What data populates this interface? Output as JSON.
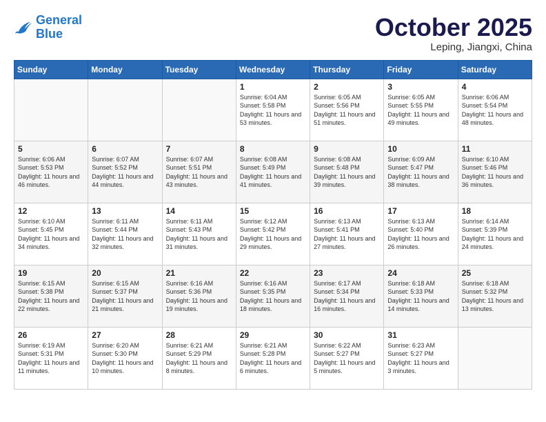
{
  "header": {
    "logo_line1": "General",
    "logo_line2": "Blue",
    "month": "October 2025",
    "location": "Leping, Jiangxi, China"
  },
  "days_of_week": [
    "Sunday",
    "Monday",
    "Tuesday",
    "Wednesday",
    "Thursday",
    "Friday",
    "Saturday"
  ],
  "weeks": [
    [
      {
        "num": "",
        "info": ""
      },
      {
        "num": "",
        "info": ""
      },
      {
        "num": "",
        "info": ""
      },
      {
        "num": "1",
        "info": "Sunrise: 6:04 AM\nSunset: 5:58 PM\nDaylight: 11 hours and 53 minutes."
      },
      {
        "num": "2",
        "info": "Sunrise: 6:05 AM\nSunset: 5:56 PM\nDaylight: 11 hours and 51 minutes."
      },
      {
        "num": "3",
        "info": "Sunrise: 6:05 AM\nSunset: 5:55 PM\nDaylight: 11 hours and 49 minutes."
      },
      {
        "num": "4",
        "info": "Sunrise: 6:06 AM\nSunset: 5:54 PM\nDaylight: 11 hours and 48 minutes."
      }
    ],
    [
      {
        "num": "5",
        "info": "Sunrise: 6:06 AM\nSunset: 5:53 PM\nDaylight: 11 hours and 46 minutes."
      },
      {
        "num": "6",
        "info": "Sunrise: 6:07 AM\nSunset: 5:52 PM\nDaylight: 11 hours and 44 minutes."
      },
      {
        "num": "7",
        "info": "Sunrise: 6:07 AM\nSunset: 5:51 PM\nDaylight: 11 hours and 43 minutes."
      },
      {
        "num": "8",
        "info": "Sunrise: 6:08 AM\nSunset: 5:49 PM\nDaylight: 11 hours and 41 minutes."
      },
      {
        "num": "9",
        "info": "Sunrise: 6:08 AM\nSunset: 5:48 PM\nDaylight: 11 hours and 39 minutes."
      },
      {
        "num": "10",
        "info": "Sunrise: 6:09 AM\nSunset: 5:47 PM\nDaylight: 11 hours and 38 minutes."
      },
      {
        "num": "11",
        "info": "Sunrise: 6:10 AM\nSunset: 5:46 PM\nDaylight: 11 hours and 36 minutes."
      }
    ],
    [
      {
        "num": "12",
        "info": "Sunrise: 6:10 AM\nSunset: 5:45 PM\nDaylight: 11 hours and 34 minutes."
      },
      {
        "num": "13",
        "info": "Sunrise: 6:11 AM\nSunset: 5:44 PM\nDaylight: 11 hours and 32 minutes."
      },
      {
        "num": "14",
        "info": "Sunrise: 6:11 AM\nSunset: 5:43 PM\nDaylight: 11 hours and 31 minutes."
      },
      {
        "num": "15",
        "info": "Sunrise: 6:12 AM\nSunset: 5:42 PM\nDaylight: 11 hours and 29 minutes."
      },
      {
        "num": "16",
        "info": "Sunrise: 6:13 AM\nSunset: 5:41 PM\nDaylight: 11 hours and 27 minutes."
      },
      {
        "num": "17",
        "info": "Sunrise: 6:13 AM\nSunset: 5:40 PM\nDaylight: 11 hours and 26 minutes."
      },
      {
        "num": "18",
        "info": "Sunrise: 6:14 AM\nSunset: 5:39 PM\nDaylight: 11 hours and 24 minutes."
      }
    ],
    [
      {
        "num": "19",
        "info": "Sunrise: 6:15 AM\nSunset: 5:38 PM\nDaylight: 11 hours and 22 minutes."
      },
      {
        "num": "20",
        "info": "Sunrise: 6:15 AM\nSunset: 5:37 PM\nDaylight: 11 hours and 21 minutes."
      },
      {
        "num": "21",
        "info": "Sunrise: 6:16 AM\nSunset: 5:36 PM\nDaylight: 11 hours and 19 minutes."
      },
      {
        "num": "22",
        "info": "Sunrise: 6:16 AM\nSunset: 5:35 PM\nDaylight: 11 hours and 18 minutes."
      },
      {
        "num": "23",
        "info": "Sunrise: 6:17 AM\nSunset: 5:34 PM\nDaylight: 11 hours and 16 minutes."
      },
      {
        "num": "24",
        "info": "Sunrise: 6:18 AM\nSunset: 5:33 PM\nDaylight: 11 hours and 14 minutes."
      },
      {
        "num": "25",
        "info": "Sunrise: 6:18 AM\nSunset: 5:32 PM\nDaylight: 11 hours and 13 minutes."
      }
    ],
    [
      {
        "num": "26",
        "info": "Sunrise: 6:19 AM\nSunset: 5:31 PM\nDaylight: 11 hours and 11 minutes."
      },
      {
        "num": "27",
        "info": "Sunrise: 6:20 AM\nSunset: 5:30 PM\nDaylight: 11 hours and 10 minutes."
      },
      {
        "num": "28",
        "info": "Sunrise: 6:21 AM\nSunset: 5:29 PM\nDaylight: 11 hours and 8 minutes."
      },
      {
        "num": "29",
        "info": "Sunrise: 6:21 AM\nSunset: 5:28 PM\nDaylight: 11 hours and 6 minutes."
      },
      {
        "num": "30",
        "info": "Sunrise: 6:22 AM\nSunset: 5:27 PM\nDaylight: 11 hours and 5 minutes."
      },
      {
        "num": "31",
        "info": "Sunrise: 6:23 AM\nSunset: 5:27 PM\nDaylight: 11 hours and 3 minutes."
      },
      {
        "num": "",
        "info": ""
      }
    ]
  ]
}
